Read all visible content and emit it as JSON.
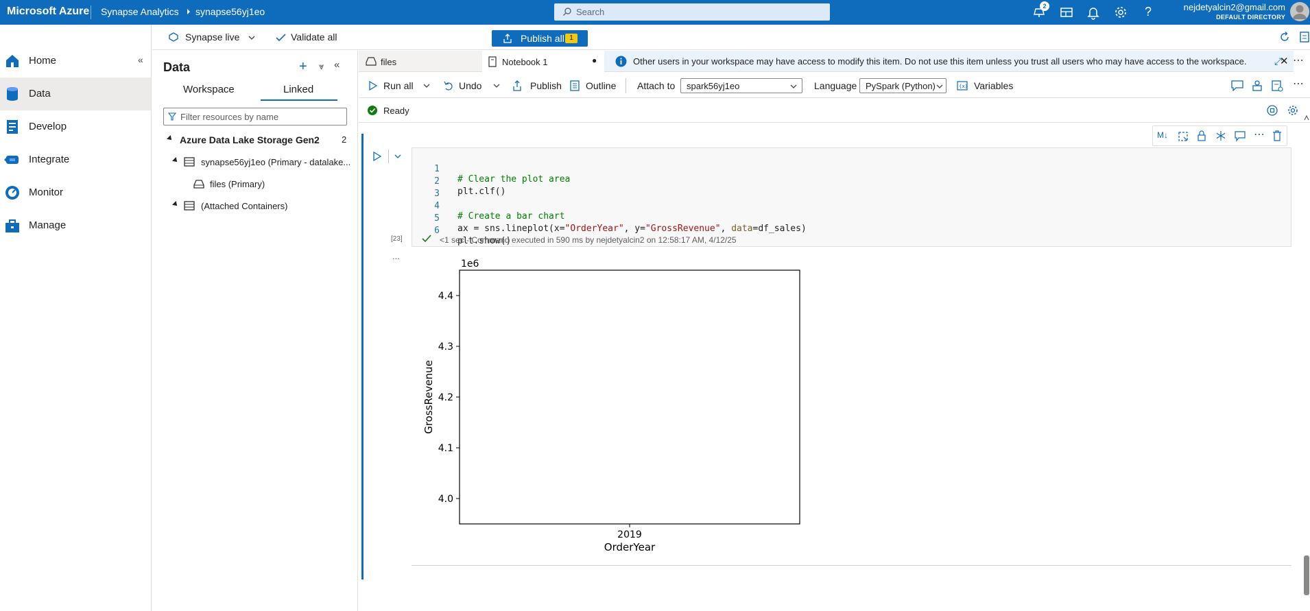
{
  "topbar": {
    "brand": "Microsoft Azure",
    "breadcrumb": [
      "Synapse Analytics",
      "synapse56yj1eo"
    ],
    "search_placeholder": "Search",
    "notifications_count": "2",
    "user_email": "nejdetyalcin2@gmail.com",
    "user_directory": "DEFAULT DIRECTORY"
  },
  "leftnav": {
    "items": [
      {
        "label": "Home",
        "icon": "home-icon"
      },
      {
        "label": "Data",
        "icon": "data-icon"
      },
      {
        "label": "Develop",
        "icon": "develop-icon"
      },
      {
        "label": "Integrate",
        "icon": "integrate-icon"
      },
      {
        "label": "Monitor",
        "icon": "monitor-icon"
      },
      {
        "label": "Manage",
        "icon": "manage-icon"
      }
    ],
    "active": "Data"
  },
  "toolbar": {
    "synapse_live": "Synapse live",
    "validate_all": "Validate all",
    "publish_all": "Publish all",
    "publish_count": "1"
  },
  "datapanel": {
    "title": "Data",
    "tabs": [
      "Workspace",
      "Linked"
    ],
    "active_tab": "Linked",
    "filter_placeholder": "Filter resources by name",
    "section": {
      "label": "Azure Data Lake Storage Gen2",
      "count": "2"
    },
    "tree": [
      {
        "label": "synapse56yj1eo (Primary - datalake..."
      },
      {
        "label": "files (Primary)"
      },
      {
        "label": "(Attached Containers)"
      }
    ]
  },
  "notebook": {
    "tabs": [
      {
        "label": "files"
      },
      {
        "label": "Notebook 1",
        "modified": "●"
      }
    ],
    "info_banner": "Other users in your workspace may have access to modify this item. Do not use this item unless you trust all users who may have access to the workspace.",
    "toolbar": {
      "run_all": "Run all",
      "undo": "Undo",
      "publish": "Publish",
      "outline": "Outline",
      "attach_to_label": "Attach to",
      "attach_to_value": "spark56yj1eo",
      "language_label": "Language",
      "language_value": "PySpark (Python)",
      "variables": "Variables"
    },
    "status": "Ready",
    "cell": {
      "exec_count": "[23]",
      "code_lines": [
        {
          "n": "1",
          "text": "# Clear the plot area"
        },
        {
          "n": "2",
          "text": "plt.clf()"
        },
        {
          "n": "3",
          "text": ""
        },
        {
          "n": "4",
          "text": "# Create a bar chart"
        },
        {
          "n": "5",
          "text": "ax = sns.lineplot(x=\"OrderYear\", y=\"GrossRevenue\", data=df_sales)"
        },
        {
          "n": "6",
          "text": "plt.show()"
        }
      ],
      "exec_info": "<1 sec - Command executed in 590 ms by nejdetyalcin2 on 12:58:17 AM, 4/12/25",
      "output_more": "...",
      "toolbar_ml": "M↓"
    }
  },
  "colors": {
    "azure_blue": "#0f6cbd",
    "success_green": "#107c10",
    "badge_yellow": "#f2c811"
  },
  "chart_data": {
    "type": "line",
    "x": [
      "2019"
    ],
    "xlabel": "OrderYear",
    "ylabel": "GrossRevenue",
    "y_ticks": [
      "4.0",
      "4.1",
      "4.2",
      "4.3",
      "4.4"
    ],
    "y_offset_label": "1e6",
    "ylim": [
      3.95,
      4.45
    ],
    "series": []
  }
}
